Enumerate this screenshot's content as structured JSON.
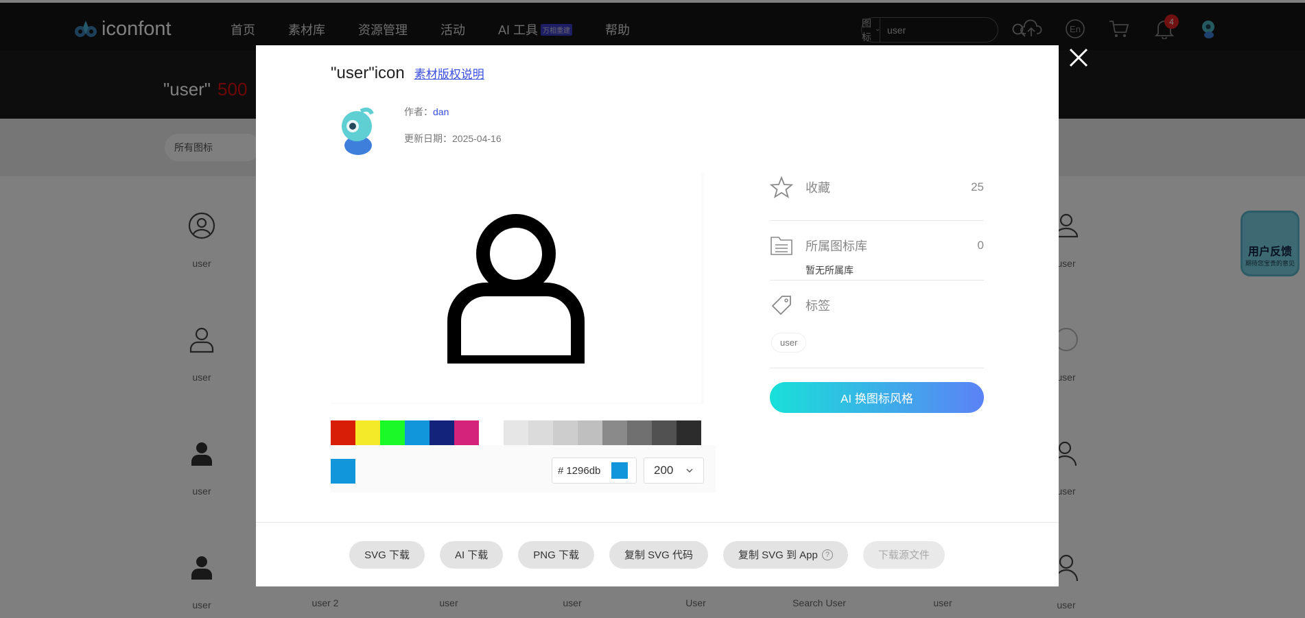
{
  "header": {
    "logo_text": "iconfont",
    "nav": [
      "首页",
      "素材库",
      "资源管理",
      "活动",
      "AI 工具",
      "帮助"
    ],
    "ai_badge": "万相重建",
    "search": {
      "type": "图标",
      "value": "user"
    },
    "notifications": "4",
    "lang_icon": "En"
  },
  "hero": {
    "title": "\"user\"",
    "count": "500"
  },
  "filter": {
    "label": "所有图标"
  },
  "grid_labels": [
    "user",
    "user",
    "user",
    "user",
    "user",
    "user 2",
    "user",
    "user",
    "User",
    "Search User",
    "user",
    "user",
    "user",
    "user",
    "user"
  ],
  "feedback": {
    "title": "用户反馈",
    "sub": "期待您宝贵的意见"
  },
  "modal": {
    "title": "\"user\"icon",
    "license": "素材版权说明",
    "author_prefix": "作者：",
    "author": "dan",
    "date_prefix": "更新日期：",
    "date": "2025-04-16",
    "palette": [
      "#d81e06",
      "#f4ea2a",
      "#1afa29",
      "#1296db",
      "#13227a",
      "#d4237a",
      "#ffffff",
      "#e6e6e6",
      "#dbdbdb",
      "#cdcdcd",
      "#bfbfbf",
      "#8a8a8a",
      "#707070",
      "#515151",
      "#2c2c2c"
    ],
    "current_color": "#1296db",
    "hex_prefix": "#",
    "hex_value": "1296db",
    "size": "200",
    "favorites_label": "收藏",
    "favorites_count": "25",
    "library_label": "所属图标库",
    "library_count": "0",
    "library_note": "暂无所属库",
    "tags_label": "标签",
    "tag": "user",
    "ai_button": "AI 换图标风格",
    "footer": {
      "svg": "SVG 下载",
      "ai": "AI 下载",
      "png": "PNG 下载",
      "copy_svg": "复制 SVG 代码",
      "copy_app": "复制 SVG 到 App",
      "help": "?",
      "source": "下载源文件"
    }
  }
}
